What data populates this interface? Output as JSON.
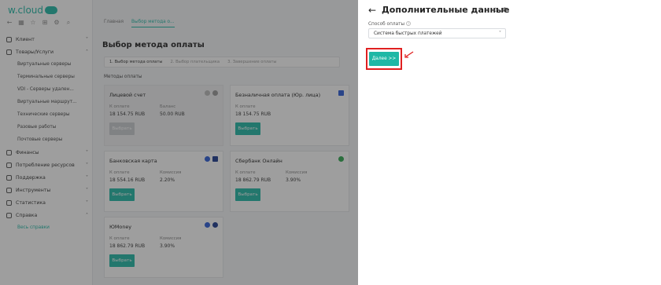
{
  "app": {
    "logo_text": "w.cloud",
    "breadcrumbs": [
      "Главная",
      "Выбор метода о..."
    ],
    "page_title": "Выбор метода оплаты",
    "steps": [
      "1. Выбор метода оплаты",
      "2. Выбор плательщика",
      "3. Завершение оплаты"
    ],
    "section_label": "Методы оплаты"
  },
  "sidebar": {
    "items": [
      {
        "label": "Клиент",
        "chev": "˅"
      },
      {
        "label": "Товары/Услуги",
        "chev": "˄"
      },
      {
        "label": "Финансы",
        "chev": "˅"
      },
      {
        "label": "Потребление ресурсов",
        "chev": "˅"
      },
      {
        "label": "Поддержка",
        "chev": "˅"
      },
      {
        "label": "Инструменты",
        "chev": "˅"
      },
      {
        "label": "Статистика",
        "chev": "˅"
      },
      {
        "label": "Справка",
        "chev": "˄"
      }
    ],
    "submenu_products": [
      "Виртуальные серверы",
      "Терминальные серверы",
      "VDI - Серверы удален...",
      "Виртуальные маршрут...",
      "Технические серверы",
      "Разовые работы",
      "Почтовые серверы"
    ],
    "submenu_help": [
      "Весь справки"
    ]
  },
  "cards": [
    {
      "title": "Лицевой счет",
      "l1": "К оплате",
      "v1": "18 154.75 RUB",
      "l2": "Баланс",
      "v2": "50.00 RUB",
      "button": "Выбрать"
    },
    {
      "title": "Безналичная оплата (Юр. лица)",
      "l1": "К оплате",
      "v1": "18 154.75 RUB",
      "l2": "",
      "v2": "",
      "button": "Выбрать"
    },
    {
      "title": "Банковская карта",
      "l1": "К оплате",
      "v1": "18 554.16 RUB",
      "l2": "Комиссия",
      "v2": "2.20%",
      "button": "Выбрать"
    },
    {
      "title": "Сбербанк Онлайн",
      "l1": "К оплате",
      "v1": "18 862.79 RUB",
      "l2": "Комиссия",
      "v2": "3.90%",
      "button": "Выбрать"
    },
    {
      "title": "ЮMoney",
      "l1": "К оплате",
      "v1": "18 862.79 RUB",
      "l2": "Комиссия",
      "v2": "3.90%",
      "button": "Выбрать"
    }
  ],
  "panel": {
    "title": "Дополнительные данные",
    "field_label": "Способ оплаты",
    "selected_method": "Система быстрых платежей",
    "next_button": "Далее >>"
  },
  "colors": {
    "accent": "#1fb8a6",
    "highlight": "#e02020"
  }
}
